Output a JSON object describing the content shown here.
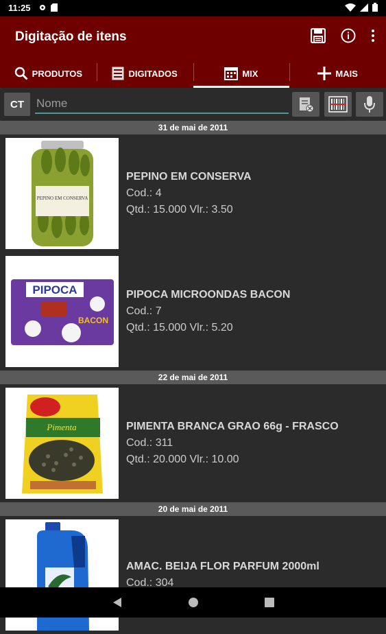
{
  "status": {
    "time": "11:25"
  },
  "app": {
    "title": "Digitação de itens"
  },
  "tabs": [
    {
      "label": "PRODUTOS"
    },
    {
      "label": "DIGITADOS"
    },
    {
      "label": "MIX"
    },
    {
      "label": "MAIS"
    }
  ],
  "search": {
    "ct_label": "CT",
    "placeholder": "Nome"
  },
  "groups": [
    {
      "date": "31 de mai de 2011",
      "items": [
        {
          "name": "PEPINO EM CONSERVA",
          "cod": "Cod.: 4",
          "qtd": "Qtd.: 15.000 Vlr.: 3.50",
          "image_label": "PEPINO EM CONSERVA"
        },
        {
          "name": "PIPOCA MICROONDAS BACON",
          "cod": "Cod.: 7",
          "qtd": "Qtd.: 15.000 Vlr.: 5.20",
          "image_label": "PIPOCA",
          "image_sub": "BACON"
        }
      ]
    },
    {
      "date": "22 de mai de 2011",
      "items": [
        {
          "name": "PIMENTA BRANCA GRAO 66g - FRASCO",
          "cod": "Cod.: 311",
          "qtd": "Qtd.: 20.000 Vlr.: 10.00",
          "image_label": "Pimenta"
        }
      ]
    },
    {
      "date": "20 de mai de 2011",
      "items": [
        {
          "name": "AMAC. BEIJA FLOR PARFUM 2000ml",
          "cod": "Cod.: 304"
        }
      ]
    }
  ],
  "colors": {
    "appbar": "#6f0000",
    "background": "#2b2b2b",
    "date_header": "#5a5a5a",
    "underline": "#4a9a9a"
  }
}
